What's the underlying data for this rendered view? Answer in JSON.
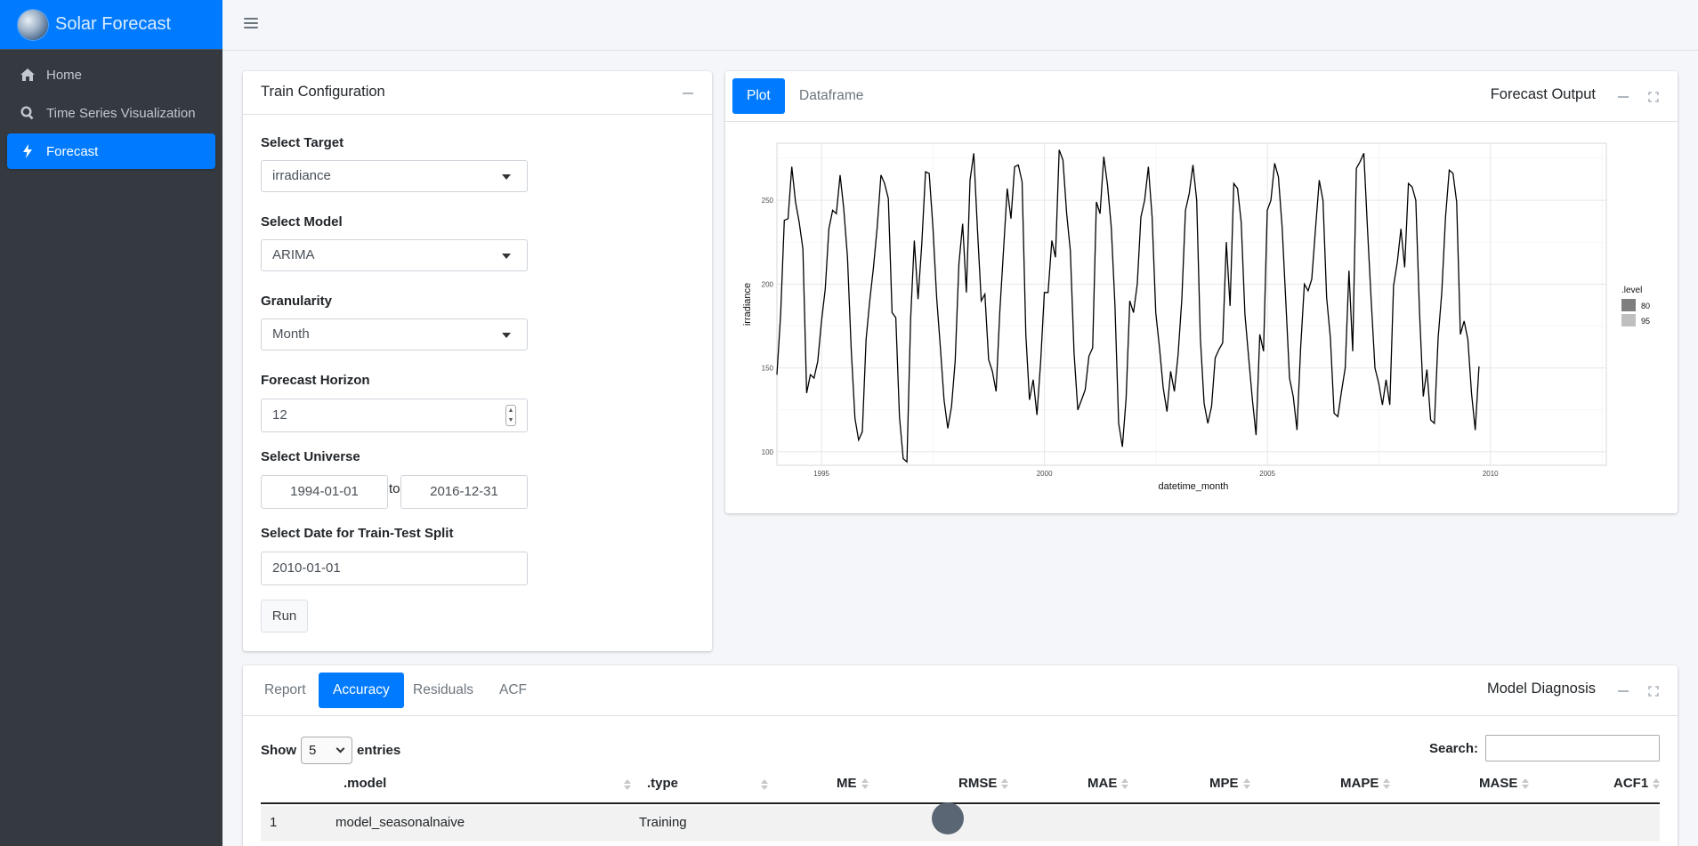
{
  "app": {
    "title": "Solar Forecast"
  },
  "sidebar": {
    "items": [
      {
        "label": "Home",
        "icon": "home-icon"
      },
      {
        "label": "Time Series Visualization",
        "icon": "search-icon"
      },
      {
        "label": "Forecast",
        "icon": "bolt-icon",
        "active": true
      }
    ]
  },
  "train": {
    "title": "Train Configuration",
    "target_label": "Select Target",
    "target_value": "irradiance",
    "model_label": "Select Model",
    "model_value": "ARIMA",
    "granularity_label": "Granularity",
    "granularity_value": "Month",
    "horizon_label": "Forecast Horizon",
    "horizon_value": "12",
    "universe_label": "Select Universe",
    "universe_start": "1994-01-01",
    "universe_to": "to",
    "universe_end": "2016-12-31",
    "split_label": "Select Date for Train-Test Split",
    "split_value": "2010-01-01",
    "run_label": "Run"
  },
  "forecast": {
    "tabs": [
      "Plot",
      "Dataframe"
    ],
    "active_tab": "Plot",
    "title": "Forecast Output"
  },
  "chart_data": {
    "type": "line",
    "xlabel": "datetime_month",
    "ylabel": "irradiance",
    "xlim": [
      1994.0,
      2012.6
    ],
    "ylim": [
      92,
      284
    ],
    "x_ticks": [
      "1995",
      "2000",
      "2005",
      "2010"
    ],
    "y_ticks": [
      "100",
      "150",
      "200",
      "250"
    ],
    "grid": true,
    "legend": {
      "title": ".level",
      "entries": [
        "80",
        "95"
      ],
      "colors": [
        "#7f7f7f",
        "#bfbfbf"
      ],
      "position": "right"
    },
    "series": [
      {
        "color": "#000000",
        "x_start": 1994.0,
        "x_step": 0.0833,
        "values": [
          146,
          182,
          238,
          239,
          270,
          249,
          237,
          221,
          135,
          146,
          144,
          154,
          178,
          197,
          233,
          244,
          242,
          265,
          245,
          216,
          161,
          120,
          107,
          112,
          167,
          190,
          210,
          234,
          265,
          260,
          251,
          183,
          180,
          121,
          96,
          94,
          180,
          226,
          191,
          224,
          267,
          266,
          234,
          192,
          162,
          131,
          114,
          127,
          154,
          212,
          236,
          195,
          262,
          278,
          232,
          190,
          194,
          155,
          148,
          136,
          183,
          220,
          257,
          239,
          270,
          271,
          261,
          170,
          131,
          143,
          122,
          154,
          195,
          195,
          226,
          216,
          280,
          274,
          242,
          220,
          159,
          125,
          131,
          137,
          157,
          162,
          249,
          242,
          276,
          259,
          234,
          188,
          117,
          103,
          132,
          190,
          183,
          200,
          240,
          250,
          270,
          240,
          183,
          162,
          138,
          124,
          148,
          136,
          158,
          191,
          244,
          254,
          271,
          250,
          168,
          129,
          117,
          127,
          156,
          161,
          165,
          225,
          187,
          260,
          257,
          237,
          182,
          156,
          131,
          110,
          170,
          160,
          244,
          250,
          272,
          264,
          234,
          190,
          144,
          133,
          113,
          162,
          200,
          196,
          203,
          233,
          262,
          250,
          192,
          168,
          123,
          121,
          136,
          150,
          208,
          160,
          269,
          273,
          278,
          232,
          190,
          150,
          141,
          128,
          143,
          128,
          199,
          213,
          233,
          210,
          260,
          258,
          250,
          183,
          133,
          149,
          119,
          117,
          168,
          195,
          240,
          268,
          266,
          249,
          170,
          178,
          167,
          135,
          113,
          151
        ]
      }
    ]
  },
  "diagnosis": {
    "tabs": [
      "Report",
      "Accuracy",
      "Residuals",
      "ACF"
    ],
    "active_tab": "Accuracy",
    "title": "Model Diagnosis",
    "show_label": "Show",
    "entries_value": "5",
    "entries_label": "entries",
    "search_label": "Search:",
    "columns": [
      ".model",
      ".type",
      "ME",
      "RMSE",
      "MAE",
      "MPE",
      "MAPE",
      "MASE",
      "ACF1"
    ],
    "rows": [
      {
        "index": "1",
        "model": "model_seasonalnaive",
        "type": "Training"
      }
    ]
  }
}
